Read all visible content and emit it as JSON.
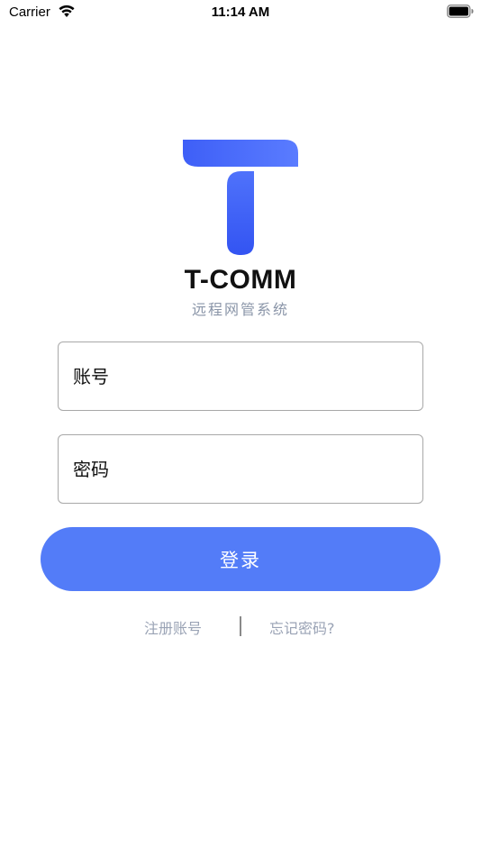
{
  "status_bar": {
    "carrier": "Carrier",
    "time": "11:14 AM"
  },
  "brand": {
    "name": "T-COMM",
    "subtitle": "远程网管系统",
    "colors": {
      "logo_top": "#4f73ff",
      "logo_bottom": "#3457f5"
    }
  },
  "form": {
    "account_placeholder": "账号",
    "password_placeholder": "密码",
    "login_label": "登录",
    "accent": "#537cf8"
  },
  "links": {
    "register_label": "注册账号",
    "forgot_label": "忘记密码?"
  }
}
